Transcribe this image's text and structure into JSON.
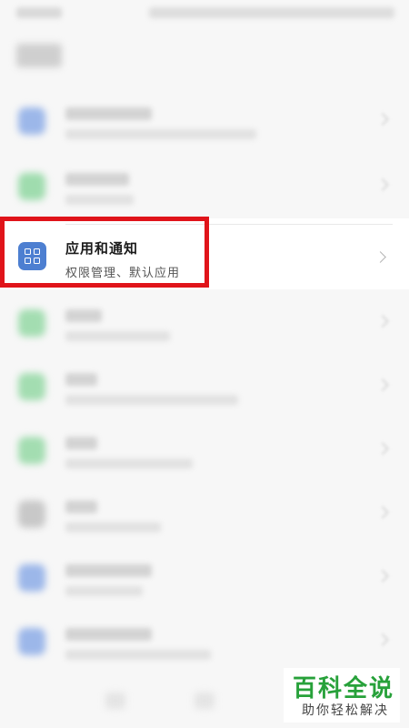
{
  "page": {
    "title": "设置"
  },
  "highlighted_item": {
    "title": "应用和通知",
    "subtitle": "权限管理、默认应用",
    "icon": "apps-grid-icon",
    "icon_color": "#4d7fd1"
  },
  "annotation": {
    "box_color": "#e0141a"
  },
  "watermark": {
    "main": "百科全说",
    "sub": "助你轻松解决",
    "color": "#27a13a"
  }
}
